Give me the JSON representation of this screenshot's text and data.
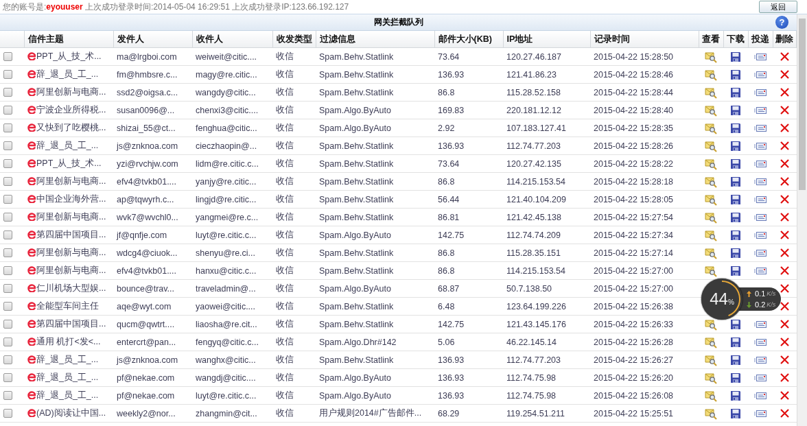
{
  "login_bar": {
    "prefix": "您的账号是:",
    "account": "eyouuser",
    "info": "上次成功登录时间:2014-05-04 16:29:51 上次成功登录IP:123.66.192.127",
    "back_button": "返回"
  },
  "panel": {
    "title": "网关拦截队列",
    "help": "?"
  },
  "table": {
    "columns": [
      "信件主题",
      "发件人",
      "收件人",
      "收发类型",
      "过滤信息",
      "邮件大小(KB)",
      "IP地址",
      "记录时间",
      "查看",
      "下载",
      "投递",
      "删除"
    ],
    "rows": [
      {
        "checked": false,
        "subject": "PPT_从_技_术...",
        "sender": "ma@lrgboi.com",
        "recipient": "weiweit@citic....",
        "type": "收信",
        "filter": "Spam.Behv.Statlink",
        "size": "73.64",
        "ip": "120.27.46.187",
        "time": "2015-04-22 15:28:50"
      },
      {
        "checked": false,
        "subject": "辞_退_员_工_...",
        "sender": "fm@hmbsre.c...",
        "recipient": "magy@re.citic...",
        "type": "收信",
        "filter": "Spam.Behv.Statlink",
        "size": "136.93",
        "ip": "121.41.86.23",
        "time": "2015-04-22 15:28:46"
      },
      {
        "checked": false,
        "subject": "阿里创新与电商...",
        "sender": "ssd2@oigsa.c...",
        "recipient": "wangdy@citic...",
        "type": "收信",
        "filter": "Spam.Behv.Statlink",
        "size": "86.8",
        "ip": "115.28.52.158",
        "time": "2015-04-22 15:28:44"
      },
      {
        "checked": false,
        "subject": "宁波企业所得税...",
        "sender": "susan0096@...",
        "recipient": "chenxi3@citic....",
        "type": "收信",
        "filter": "Spam.Algo.ByAuto",
        "size": "169.83",
        "ip": "220.181.12.12",
        "time": "2015-04-22 15:28:40"
      },
      {
        "checked": false,
        "subject": "又快到了吃樱桃...",
        "sender": "shizai_55@ct...",
        "recipient": "fenghua@citic...",
        "type": "收信",
        "filter": "Spam.Algo.ByAuto",
        "size": "2.92",
        "ip": "107.183.127.41",
        "time": "2015-04-22 15:28:35"
      },
      {
        "checked": false,
        "subject": "辞_退_员_工_...",
        "sender": "js@znknoa.com",
        "recipient": "cieczhaopin@...",
        "type": "收信",
        "filter": "Spam.Behv.Statlink",
        "size": "136.93",
        "ip": "112.74.77.203",
        "time": "2015-04-22 15:28:26"
      },
      {
        "checked": false,
        "subject": "PPT_从_技_术...",
        "sender": "yzi@rvchjw.com",
        "recipient": "lidm@re.citic.c...",
        "type": "收信",
        "filter": "Spam.Behv.Statlink",
        "size": "73.64",
        "ip": "120.27.42.135",
        "time": "2015-04-22 15:28:22"
      },
      {
        "checked": false,
        "subject": "阿里创新与电商...",
        "sender": "efv4@tvkb01....",
        "recipient": "yanjy@re.citic...",
        "type": "收信",
        "filter": "Spam.Behv.Statlink",
        "size": "86.8",
        "ip": "114.215.153.54",
        "time": "2015-04-22 15:28:18"
      },
      {
        "checked": false,
        "subject": "中国企业海外营...",
        "sender": "ap@tqwyrh.c...",
        "recipient": "lingjd@re.citic...",
        "type": "收信",
        "filter": "Spam.Behv.Statlink",
        "size": "56.44",
        "ip": "121.40.104.209",
        "time": "2015-04-22 15:28:05"
      },
      {
        "checked": false,
        "subject": "阿里创新与电商...",
        "sender": "wvk7@wvchl0...",
        "recipient": "yangmei@re.c...",
        "type": "收信",
        "filter": "Spam.Behv.Statlink",
        "size": "86.81",
        "ip": "121.42.45.138",
        "time": "2015-04-22 15:27:54"
      },
      {
        "checked": false,
        "subject": "第四届中国项目...",
        "sender": "jf@qnfje.com",
        "recipient": "luyt@re.citic.c...",
        "type": "收信",
        "filter": "Spam.Algo.ByAuto",
        "size": "142.75",
        "ip": "112.74.74.209",
        "time": "2015-04-22 15:27:34"
      },
      {
        "checked": false,
        "subject": "阿里创新与电商...",
        "sender": "wdcg4@ciuok...",
        "recipient": "shenyu@re.ci...",
        "type": "收信",
        "filter": "Spam.Behv.Statlink",
        "size": "86.8",
        "ip": "115.28.35.151",
        "time": "2015-04-22 15:27:14"
      },
      {
        "checked": false,
        "subject": "阿里创新与电商...",
        "sender": "efv4@tvkb01....",
        "recipient": "hanxu@citic.c...",
        "type": "收信",
        "filter": "Spam.Behv.Statlink",
        "size": "86.8",
        "ip": "114.215.153.54",
        "time": "2015-04-22 15:27:00"
      },
      {
        "checked": false,
        "covered": true,
        "subject": "仁川机场大型娱...",
        "sender": "bounce@trav...",
        "recipient": "traveladmin@...",
        "type": "收信",
        "filter": "Spam.Algo.ByAuto",
        "size": "68.87",
        "ip": "50.7.138.50",
        "time": "2015-04-22 15:27:00"
      },
      {
        "checked": false,
        "covered": true,
        "subject": "全能型车间主任",
        "sender": "aqe@wyt.com",
        "recipient": "yaowei@citic....",
        "type": "收信",
        "filter": "Spam.Behv.Statlink",
        "size": "6.48",
        "ip": "123.64.199.226",
        "time": "2015-04-22 15:26:38"
      },
      {
        "checked": false,
        "subject": "第四届中国项目...",
        "sender": "qucm@qwtrt....",
        "recipient": "liaosha@re.cit...",
        "type": "收信",
        "filter": "Spam.Behv.Statlink",
        "size": "142.75",
        "ip": "121.43.145.176",
        "time": "2015-04-22 15:26:33"
      },
      {
        "checked": false,
        "subject": "通用 机打<发<...",
        "sender": "entercrt@pan...",
        "recipient": "fengyq@citic.c...",
        "type": "收信",
        "filter": "Spam.Algo.Dhr#142",
        "size": "5.06",
        "ip": "46.22.145.14",
        "time": "2015-04-22 15:26:28"
      },
      {
        "checked": false,
        "subject": "辞_退_员_工_...",
        "sender": "js@znknoa.com",
        "recipient": "wanghx@citic...",
        "type": "收信",
        "filter": "Spam.Behv.Statlink",
        "size": "136.93",
        "ip": "112.74.77.203",
        "time": "2015-04-22 15:26:27"
      },
      {
        "checked": false,
        "subject": "辞_退_员_工_...",
        "sender": "pf@nekae.com",
        "recipient": "wangdj@citic....",
        "type": "收信",
        "filter": "Spam.Algo.ByAuto",
        "size": "136.93",
        "ip": "112.74.75.98",
        "time": "2015-04-22 15:26:20"
      },
      {
        "checked": false,
        "subject": "辞_退_员_工_...",
        "sender": "pf@nekae.com",
        "recipient": "luyt@re.citic.c...",
        "type": "收信",
        "filter": "Spam.Algo.ByAuto",
        "size": "136.93",
        "ip": "112.74.75.98",
        "time": "2015-04-22 15:26:08"
      },
      {
        "checked": false,
        "subject": "(AD)阅读让中国...",
        "sender": "weekly2@nor...",
        "recipient": "zhangmin@cit...",
        "type": "收信",
        "filter": "用户规则2014#广告邮件...",
        "size": "68.29",
        "ip": "119.254.51.211",
        "time": "2015-04-22 15:25:51"
      }
    ]
  },
  "speed_widget": {
    "percent": "44",
    "percent_sign": "%",
    "level": 0.44,
    "upload": "0.1",
    "upload_unit": "K/s",
    "download": "0.2",
    "download_unit": "K/s"
  }
}
